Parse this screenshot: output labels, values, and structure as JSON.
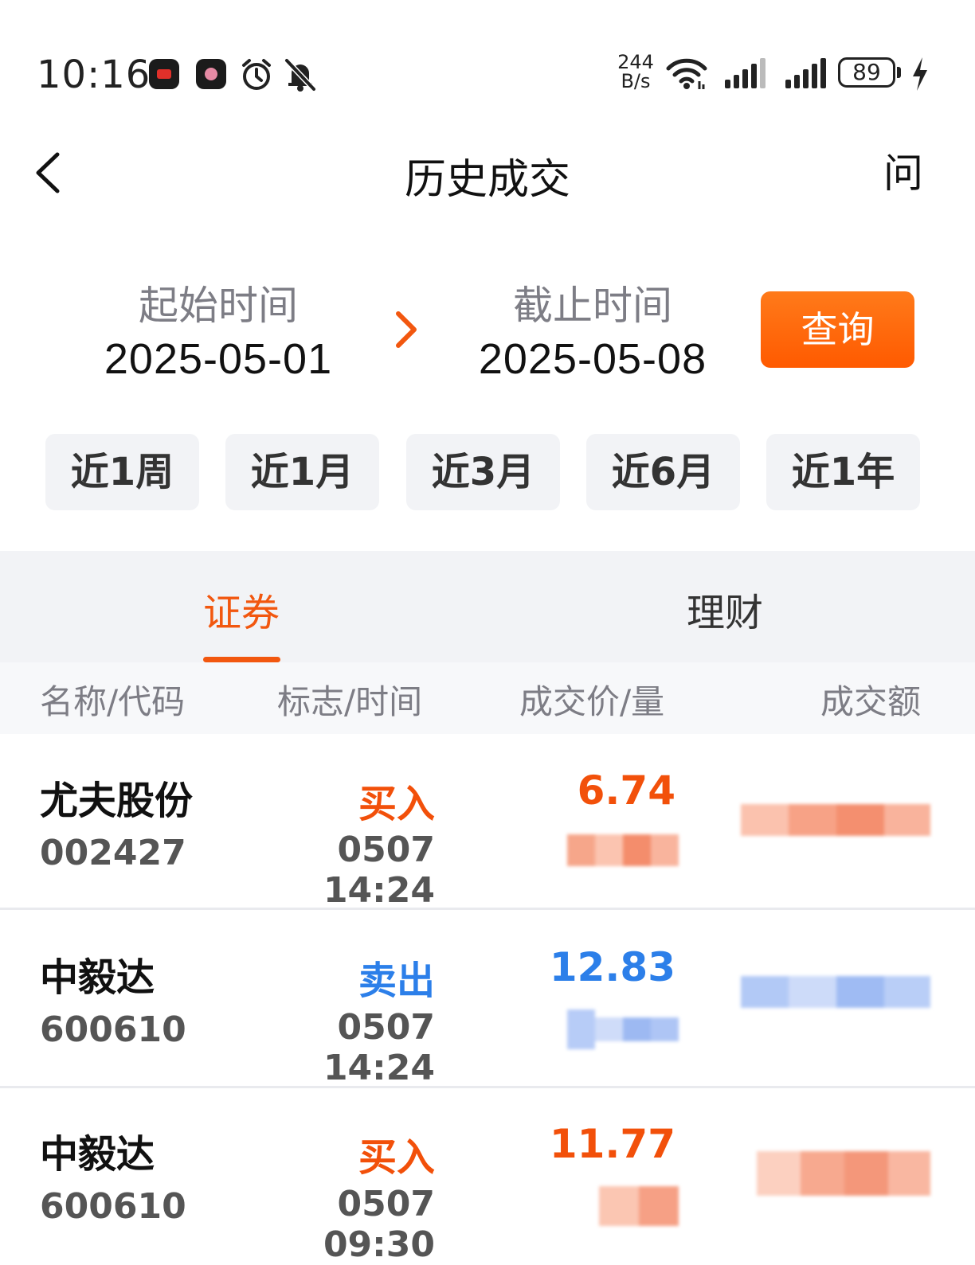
{
  "status_bar": {
    "time": "10:16",
    "net_speed_value": "244",
    "net_speed_unit": "B/s",
    "battery": "89",
    "icons": [
      "app-red-icon",
      "app-pink-icon",
      "alarm-icon",
      "bell-off-icon",
      "wifi-icon",
      "signal-icon",
      "signal-icon",
      "battery-icon",
      "charging-icon"
    ]
  },
  "nav": {
    "title": "历史成交",
    "help_label": "问",
    "back_icon": "chevron-left-icon"
  },
  "date_range": {
    "start_label": "起始时间",
    "start_value": "2025-05-01",
    "end_label": "截止时间",
    "end_value": "2025-05-08",
    "query_label": "查询"
  },
  "quick_periods": [
    "近1周",
    "近1月",
    "近3月",
    "近6月",
    "近1年"
  ],
  "tabs": [
    {
      "label": "证券",
      "active": true
    },
    {
      "label": "理财",
      "active": false
    }
  ],
  "table": {
    "headers": [
      "名称/代码",
      "标志/时间",
      "成交价/量",
      "成交额"
    ],
    "rows": [
      {
        "name": "尤夫股份",
        "code": "002427",
        "side": "买入",
        "time": "0507 14:24",
        "price": "6.74",
        "side_type": "buy"
      },
      {
        "name": "中毅达",
        "code": "600610",
        "side": "卖出",
        "time": "0507 14:24",
        "price": "12.83",
        "side_type": "sell"
      },
      {
        "name": "中毅达",
        "code": "600610",
        "side": "买入",
        "time": "0507 09:30",
        "price": "11.77",
        "side_type": "buy"
      }
    ]
  },
  "colors": {
    "accent": "#f2570f",
    "buy": "#f2500a",
    "sell": "#2c7fe9",
    "query_button": "#ff6a0d"
  }
}
